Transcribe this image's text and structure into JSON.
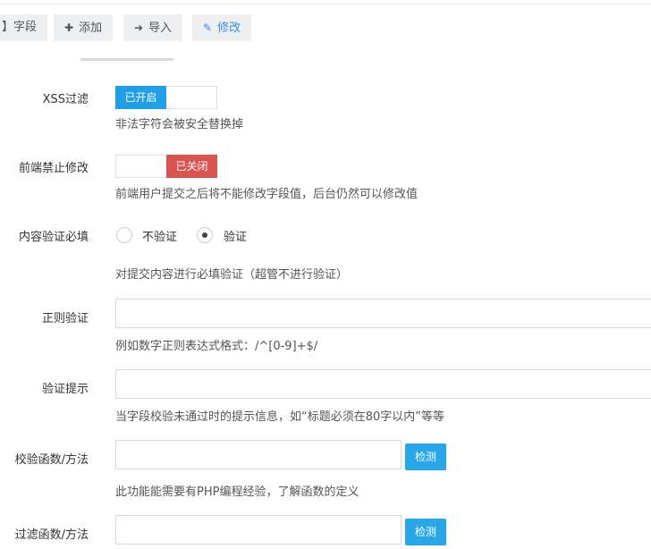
{
  "toolbar": {
    "fields_label": "】字段",
    "add_label": "添加",
    "import_label": "导入",
    "edit_label": "修改"
  },
  "form": {
    "xss": {
      "label": "XSS过滤",
      "state": "已开启",
      "help": "非法字符会被安全替换掉"
    },
    "frontend_lock": {
      "label": "前端禁止修改",
      "state": "已关闭",
      "help": "前端用户提交之后将不能修改字段值，后台仍然可以修改值"
    },
    "required": {
      "label": "内容验证必填",
      "options": [
        "不验证",
        "验证"
      ],
      "selected": "验证",
      "help": "对提交内容进行必填验证（超管不进行验证）"
    },
    "regex": {
      "label": "正则验证",
      "value": "",
      "help": "例如数字正则表达式格式：/^[0-9]+$/"
    },
    "tip": {
      "label": "验证提示",
      "value": "",
      "help": "当字段校验未通过时的提示信息，如“标题必须在80字以内”等等"
    },
    "check_func": {
      "label": "校验函数/方法",
      "value": "",
      "button": "检测",
      "help": "此功能能需要有PHP编程经验，了解函数的定义"
    },
    "filter_func": {
      "label": "过滤函数/方法",
      "value": "",
      "button": "检测"
    }
  },
  "icons": {
    "add": "plus-icon",
    "import": "sign-in-icon",
    "edit": "pencil-square-icon"
  },
  "colors": {
    "switch_on": "#1e9fe8",
    "switch_off": "#d9534f",
    "check_button": "#27a6ea",
    "active_tab": "#3a8ee6"
  }
}
